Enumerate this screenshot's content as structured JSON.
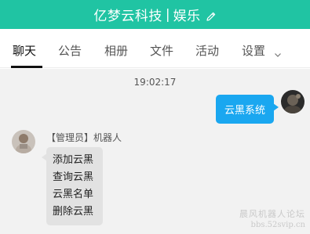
{
  "header": {
    "title": "亿梦云科技",
    "separator": "|",
    "subtitle": "娱乐",
    "edit_icon": "pencil-icon",
    "bg_color": "#20c4a3"
  },
  "tabs": [
    {
      "label": "聊天",
      "active": true
    },
    {
      "label": "公告",
      "active": false
    },
    {
      "label": "相册",
      "active": false
    },
    {
      "label": "文件",
      "active": false
    },
    {
      "label": "活动",
      "active": false
    },
    {
      "label": "设置",
      "active": false,
      "icon": "chevron-down-icon"
    }
  ],
  "chat": {
    "timestamp": "19:02:17",
    "outgoing": {
      "text": "云黑系统",
      "bubble_color": "#1aa7f0"
    },
    "incoming": {
      "sender": "【管理员】机器人",
      "lines": [
        "添加云黑",
        "查询云黑",
        "云黑名单",
        "删除云黑"
      ]
    }
  },
  "watermark": {
    "line1": "晨风机器人论坛",
    "line2": "bbs.52svip.cn"
  }
}
